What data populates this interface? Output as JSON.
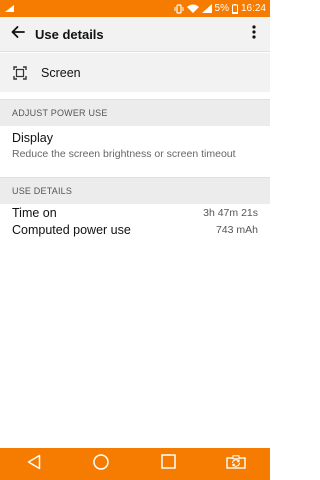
{
  "status_bar": {
    "battery_percent": "5%",
    "time": "16:24"
  },
  "app_bar": {
    "title": "Use details"
  },
  "app": {
    "name": "Screen"
  },
  "adjust_section": {
    "header": "ADJUST POWER USE",
    "item_title": "Display",
    "item_subtitle": "Reduce the screen brightness or screen timeout"
  },
  "use_details_section": {
    "header": "USE DETAILS",
    "rows": [
      {
        "label": "Time on",
        "value": "3h 47m 21s"
      },
      {
        "label": "Computed power use",
        "value": "743 mAh"
      }
    ]
  },
  "colors": {
    "accent": "#f57c00"
  }
}
